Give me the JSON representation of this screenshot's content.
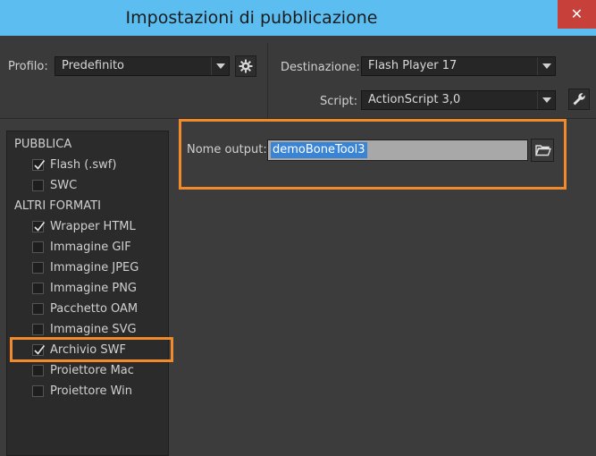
{
  "window": {
    "title": "Impostazioni di pubblicazione",
    "close_glyph": "✕"
  },
  "profile": {
    "label": "Profilo:",
    "value": "Predefinito",
    "settings_icon": "gear-icon"
  },
  "target": {
    "label": "Destinazione:",
    "value": "Flash Player 17"
  },
  "script": {
    "label": "Script:",
    "value": "ActionScript 3,0",
    "settings_icon": "wrench-icon"
  },
  "publish": {
    "section_label": "PUBBLICA",
    "items": [
      {
        "label": "Flash (.swf)",
        "checked": true
      },
      {
        "label": "SWC",
        "checked": false
      }
    ]
  },
  "other_formats": {
    "section_label": "ALTRI FORMATI",
    "items": [
      {
        "label": "Wrapper HTML",
        "checked": true
      },
      {
        "label": "Immagine GIF",
        "checked": false
      },
      {
        "label": "Immagine JPEG",
        "checked": false
      },
      {
        "label": "Immagine PNG",
        "checked": false
      },
      {
        "label": "Pacchetto OAM",
        "checked": false
      },
      {
        "label": "Immagine SVG",
        "checked": false
      },
      {
        "label": "Archivio SWF",
        "checked": true
      },
      {
        "label": "Proiettore Mac",
        "checked": false
      },
      {
        "label": "Proiettore Win",
        "checked": false
      }
    ]
  },
  "output": {
    "label": "Nome output:",
    "value": "demoBoneTool3",
    "browse_icon": "folder-icon"
  },
  "colors": {
    "title_bar": "#5bbdf0",
    "highlight": "#f08a2a",
    "close_button": "#c7403a",
    "selection": "#3a84d6"
  }
}
